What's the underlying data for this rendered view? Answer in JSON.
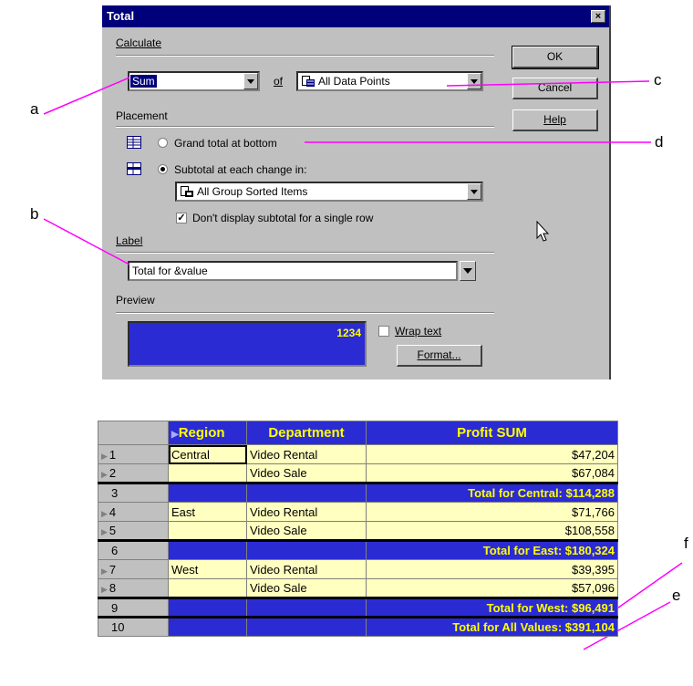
{
  "dialog": {
    "title": "Total",
    "calculate_label": "Calculate",
    "function_value": "Sum",
    "of_label": "of",
    "of_value": "All Data Points",
    "ok_label": "OK",
    "cancel_label": "Cancel",
    "help_label": "Help",
    "placement_label": "Placement",
    "grand_total_label": "Grand total at bottom",
    "subtotal_label": "Subtotal at each change in:",
    "subtotal_value": "All Group Sorted Items",
    "dont_display_label": "Don't display subtotal for a single row",
    "label_label": "Label",
    "label_value": "Total for &value",
    "preview_label": "Preview",
    "preview_value": "1234",
    "wrap_text_label": "Wrap text",
    "format_label": "Format..."
  },
  "callouts": {
    "a": "a",
    "b": "b",
    "c": "c",
    "d": "d",
    "e": "e",
    "f": "f"
  },
  "table": {
    "headers": [
      "Region",
      "Department",
      "Profit SUM"
    ],
    "rows": [
      {
        "n": "1",
        "region": "Central",
        "dept": "Video Rental",
        "profit": "$47,204",
        "total": false
      },
      {
        "n": "2",
        "region": "",
        "dept": "Video Sale",
        "profit": "$67,084",
        "total": false
      },
      {
        "n": "3",
        "region": "",
        "dept": "",
        "profit": "Total for Central: $114,288",
        "total": true
      },
      {
        "n": "4",
        "region": "East",
        "dept": "Video Rental",
        "profit": "$71,766",
        "total": false
      },
      {
        "n": "5",
        "region": "",
        "dept": "Video Sale",
        "profit": "$108,558",
        "total": false
      },
      {
        "n": "6",
        "region": "",
        "dept": "",
        "profit": "Total for East: $180,324",
        "total": true
      },
      {
        "n": "7",
        "region": "West",
        "dept": "Video Rental",
        "profit": "$39,395",
        "total": false
      },
      {
        "n": "8",
        "region": "",
        "dept": "Video Sale",
        "profit": "$57,096",
        "total": false
      },
      {
        "n": "9",
        "region": "",
        "dept": "",
        "profit": "Total for West: $96,491",
        "total": true
      },
      {
        "n": "10",
        "region": "",
        "dept": "",
        "profit": "Total for All Values: $391,104",
        "total": true
      }
    ]
  },
  "colors": {
    "title_bar": "#00007b",
    "blue_cell": "#2b2bd4",
    "yellow_text": "#ffff00",
    "yellow_cell": "#ffffc0",
    "callout_line": "#ff00ff"
  }
}
